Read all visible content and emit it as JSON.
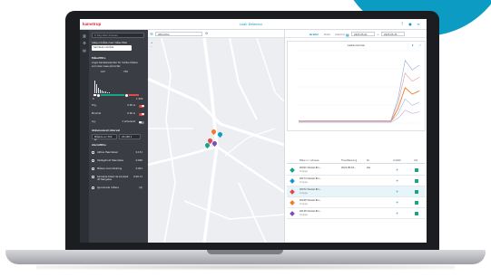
{
  "brand": {
    "logo": "kamstrup",
    "app_title": "Leak Detector",
    "accent": "#1497c9",
    "brand_red": "#d7263d",
    "decor_teal": "#0c9bc2"
  },
  "panel": {
    "search_placeholder": "Q  Søg efter adresse",
    "area_label": "Vælg område med måler-filter",
    "area_value": "Samlede område",
    "filters_heading": "Målerfiltre",
    "filters_help_1": "Angiv tærskelværdier for hvilke målere",
    "filters_help_2": "som skal vises på kortet",
    "range_min_label": "107",
    "range_max_label": "750",
    "scale_start": "0",
    "scale_end": "1.500",
    "rows": [
      {
        "label": "Tilg.",
        "value": "0.00 ⊗",
        "on": true
      },
      {
        "label": "Minimal",
        "value": "0.00 ⊗",
        "on": true
      },
      {
        "label": "Lig.",
        "value": "1 simuleret",
        "on": false
      }
    ],
    "section_acc": "Akkumuleret interval",
    "acc_select": "Måleris er i fint er",
    "acc_select2": "24.200 ▾",
    "section_alarm": "Alarmfiltre",
    "alarms": [
      {
        "label": "Aktive Hændelser",
        "value": "0.131"
      },
      {
        "label": "Vedligehold Hændelse",
        "value": "0.066"
      },
      {
        "label": "Målere med afvikling",
        "value": "0.001"
      },
      {
        "label": "Samlede tilslut de konstelr ikt fængelse",
        "value": "0.00.71"
      },
      {
        "label": "Ignorerede målere",
        "value": "(0)"
      }
    ]
  },
  "map": {
    "select_value": "Afkoruthe",
    "zoom_in": "+",
    "zoom_out": "–"
  },
  "right": {
    "tabs": [
      "Grafer",
      "Data",
      "Alarmer"
    ],
    "date_from": "2023-05-01",
    "date_to": "2023-05-31",
    "chart_title": "Lækkvolumen",
    "table_headers": [
      "",
      "Måler-nr / adresse",
      "Flowaflæsning",
      "Nr.",
      "",
      "Indstilli",
      "Vist"
    ],
    "rows": [
      {
        "icon_color": "#16a388",
        "addr": "20021 Vilanke Bro...",
        "sub": "Gruppe",
        "date": "2023-08-18...",
        "nr": "Alle",
        "sel": false
      },
      {
        "icon_color": "#1497c9",
        "addr": "20174 Vilanke Bro...",
        "sub": "Gruppe",
        "date": "",
        "nr": "",
        "sel": false
      },
      {
        "icon_color": "#e44848",
        "addr": "20072 Vilanke Bro...",
        "sub": "Gruppe",
        "date": "",
        "nr": "",
        "sel": true
      },
      {
        "icon_color": "#f07a2a",
        "addr": "20228 Vilanke Bro...",
        "sub": "Gruppe",
        "date": "",
        "nr": "",
        "sel": false
      },
      {
        "icon_color": "#7d4fb3",
        "addr": "20128 Vilanke Bro...",
        "sub": "Gruppe",
        "date": "",
        "nr": "",
        "sel": false
      }
    ]
  },
  "chart_data": {
    "type": "line",
    "title": "Lækkvolumen",
    "x": [
      1,
      2,
      3,
      4,
      5,
      6,
      7,
      8,
      9,
      10,
      11,
      12,
      13,
      14,
      15,
      16,
      17,
      18
    ],
    "series": [
      {
        "color": "#8faedd",
        "values": [
          3,
          3,
          3,
          3,
          3,
          3,
          3,
          3,
          3,
          3,
          3,
          3,
          3,
          3,
          30,
          78,
          66,
          72
        ]
      },
      {
        "color": "#e39a9a",
        "values": [
          3,
          3,
          3,
          3,
          3,
          3,
          3,
          3,
          3,
          3,
          3,
          3,
          3,
          3,
          25,
          62,
          52,
          57
        ]
      },
      {
        "color": "#f07a2a",
        "values": [
          2,
          2,
          2,
          2,
          2,
          2,
          2,
          2,
          2,
          2,
          2,
          2,
          2,
          2,
          18,
          44,
          36,
          40
        ]
      },
      {
        "color": "#9fb7d6",
        "values": [
          2,
          2,
          2,
          2,
          2,
          2,
          2,
          2,
          2,
          2,
          2,
          2,
          2,
          2,
          12,
          30,
          22,
          26
        ]
      },
      {
        "color": "#c9a8d8",
        "values": [
          1,
          1,
          1,
          1,
          1,
          1,
          1,
          1,
          1,
          1,
          1,
          1,
          1,
          1,
          6,
          16,
          12,
          14
        ]
      }
    ],
    "ylim": [
      0,
      90
    ]
  }
}
